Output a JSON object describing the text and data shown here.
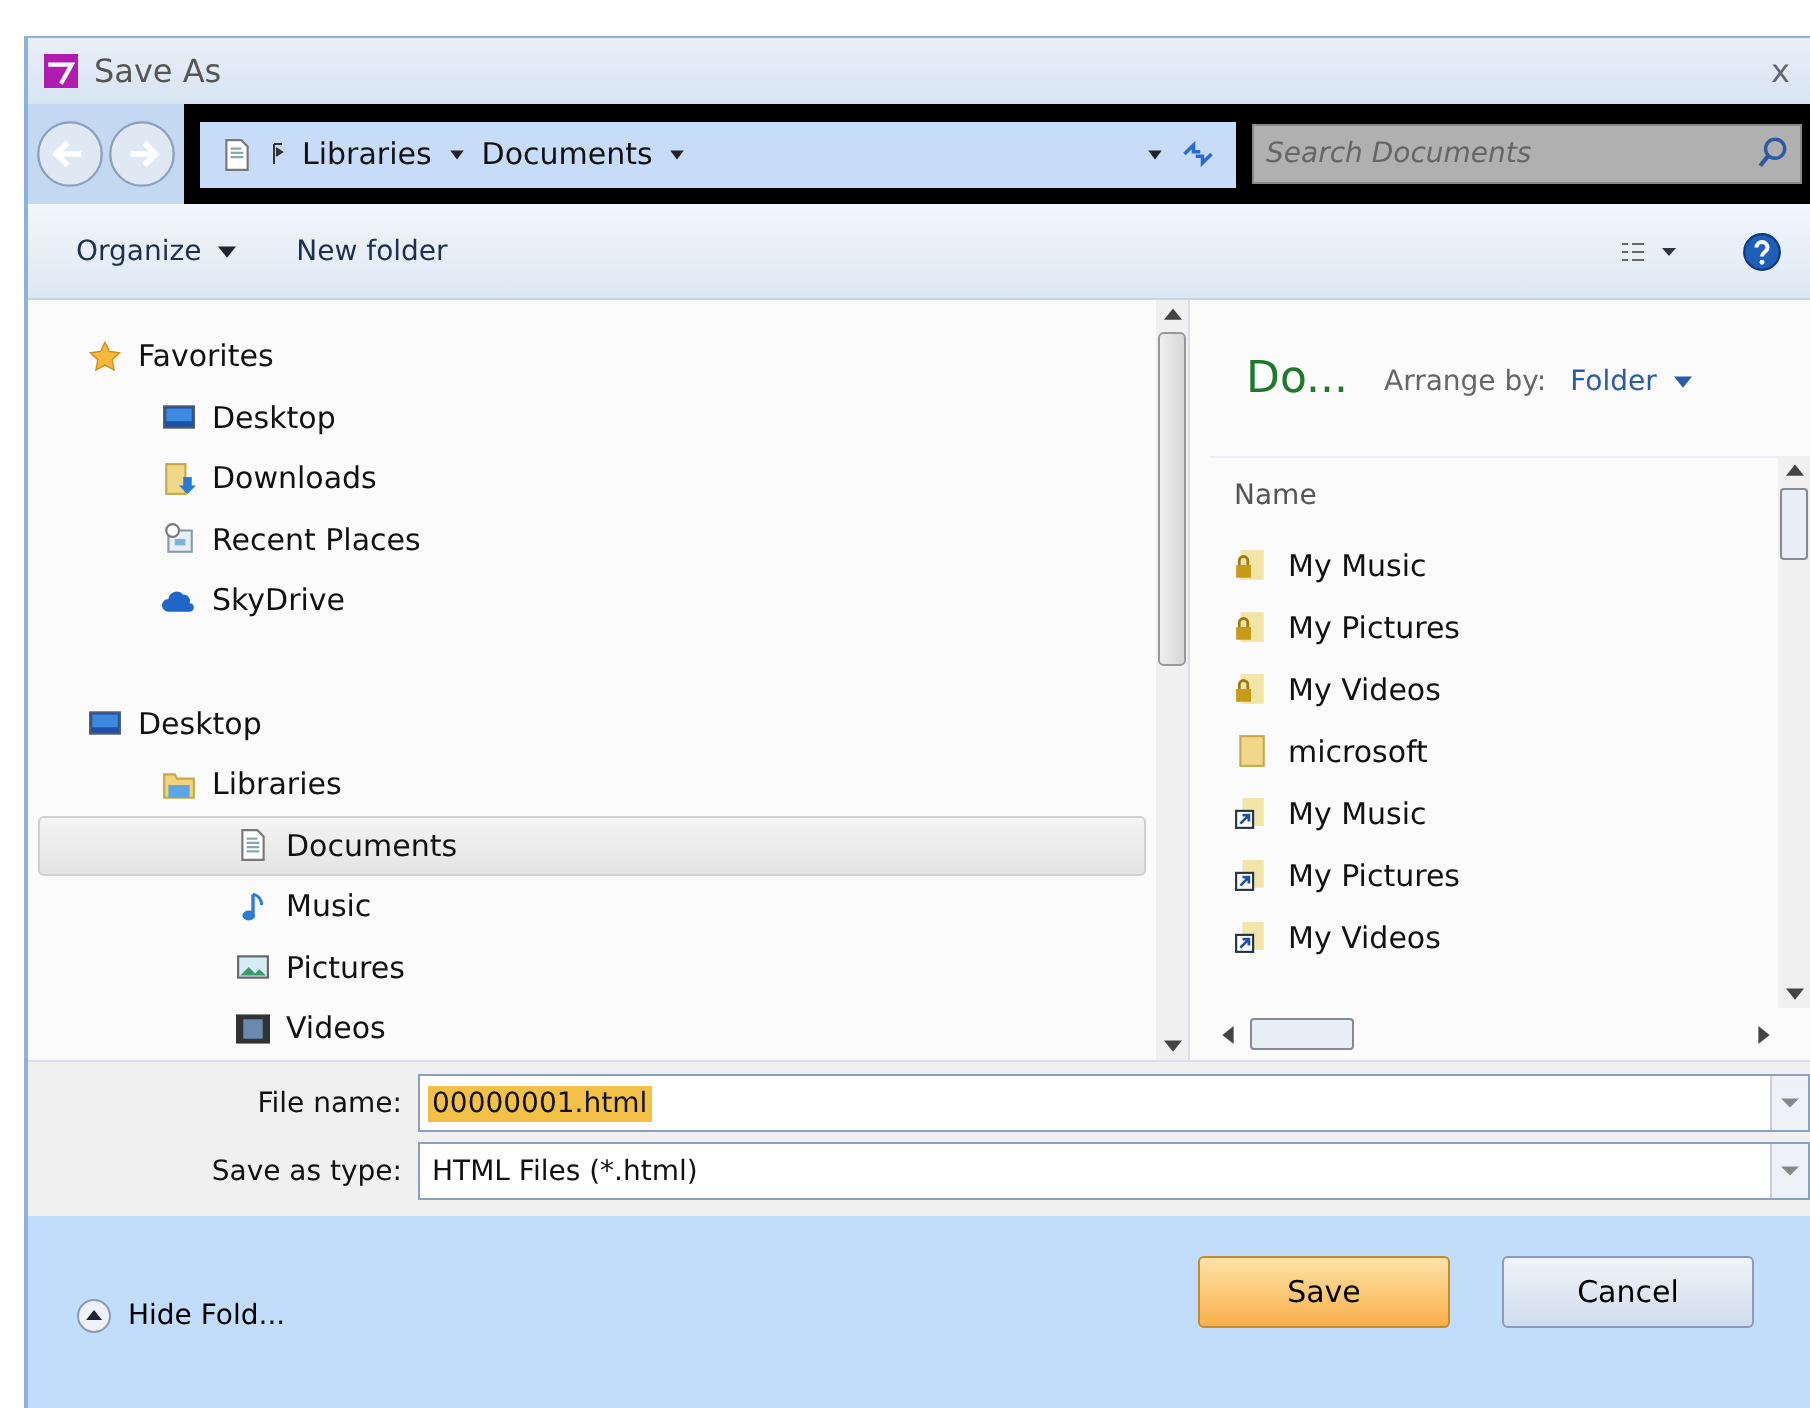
{
  "window": {
    "title": "Save As",
    "close": "x"
  },
  "address_bar": {
    "crumbs": [
      "Libraries",
      "Documents"
    ],
    "search": {
      "placeholder": "Search Documents"
    }
  },
  "toolbar": {
    "organize": "Organize",
    "new_folder": "New folder"
  },
  "navigation": [
    {
      "label": "Favorites",
      "kind": "star",
      "selected": false,
      "children": [
        {
          "label": "Desktop",
          "kind": "desktop",
          "selected": false
        },
        {
          "label": "Downloads",
          "kind": "downloads",
          "selected": false
        },
        {
          "label": "Recent Places",
          "kind": "recent",
          "selected": false
        },
        {
          "label": "SkyDrive",
          "kind": "cloud",
          "selected": false
        }
      ]
    },
    {
      "label": "Desktop",
      "kind": "desktop",
      "selected": false,
      "children": [
        {
          "label": "Libraries",
          "kind": "library",
          "selected": false,
          "children": [
            {
              "label": "Documents",
              "kind": "document",
              "selected": true
            },
            {
              "label": "Music",
              "kind": "music",
              "selected": false
            },
            {
              "label": "Pictures",
              "kind": "pictures",
              "selected": false
            },
            {
              "label": "Videos",
              "kind": "videos",
              "selected": false
            }
          ]
        }
      ]
    }
  ],
  "content": {
    "heading": "Do...",
    "arrange_label": "Arrange by:",
    "arrange_value": "Folder",
    "column": "Name",
    "files": [
      {
        "name": "My Music",
        "kind": "locked-folder"
      },
      {
        "name": "My Pictures",
        "kind": "locked-folder"
      },
      {
        "name": "My Videos",
        "kind": "locked-folder"
      },
      {
        "name": "microsoft",
        "kind": "folder"
      },
      {
        "name": "My Music",
        "kind": "shortcut"
      },
      {
        "name": "My Pictures",
        "kind": "shortcut"
      },
      {
        "name": "My Videos",
        "kind": "shortcut"
      }
    ]
  },
  "fields": [
    {
      "label": "File name:",
      "value": "00000001.html",
      "value_selected": true
    },
    {
      "label": "Save as type:",
      "value": "HTML Files (*.html)",
      "value_selected": false
    }
  ],
  "footer": {
    "toggle": "Hide Fold...",
    "buttons": [
      {
        "label": "Save",
        "default": true
      },
      {
        "label": "Cancel",
        "default": false
      }
    ]
  }
}
